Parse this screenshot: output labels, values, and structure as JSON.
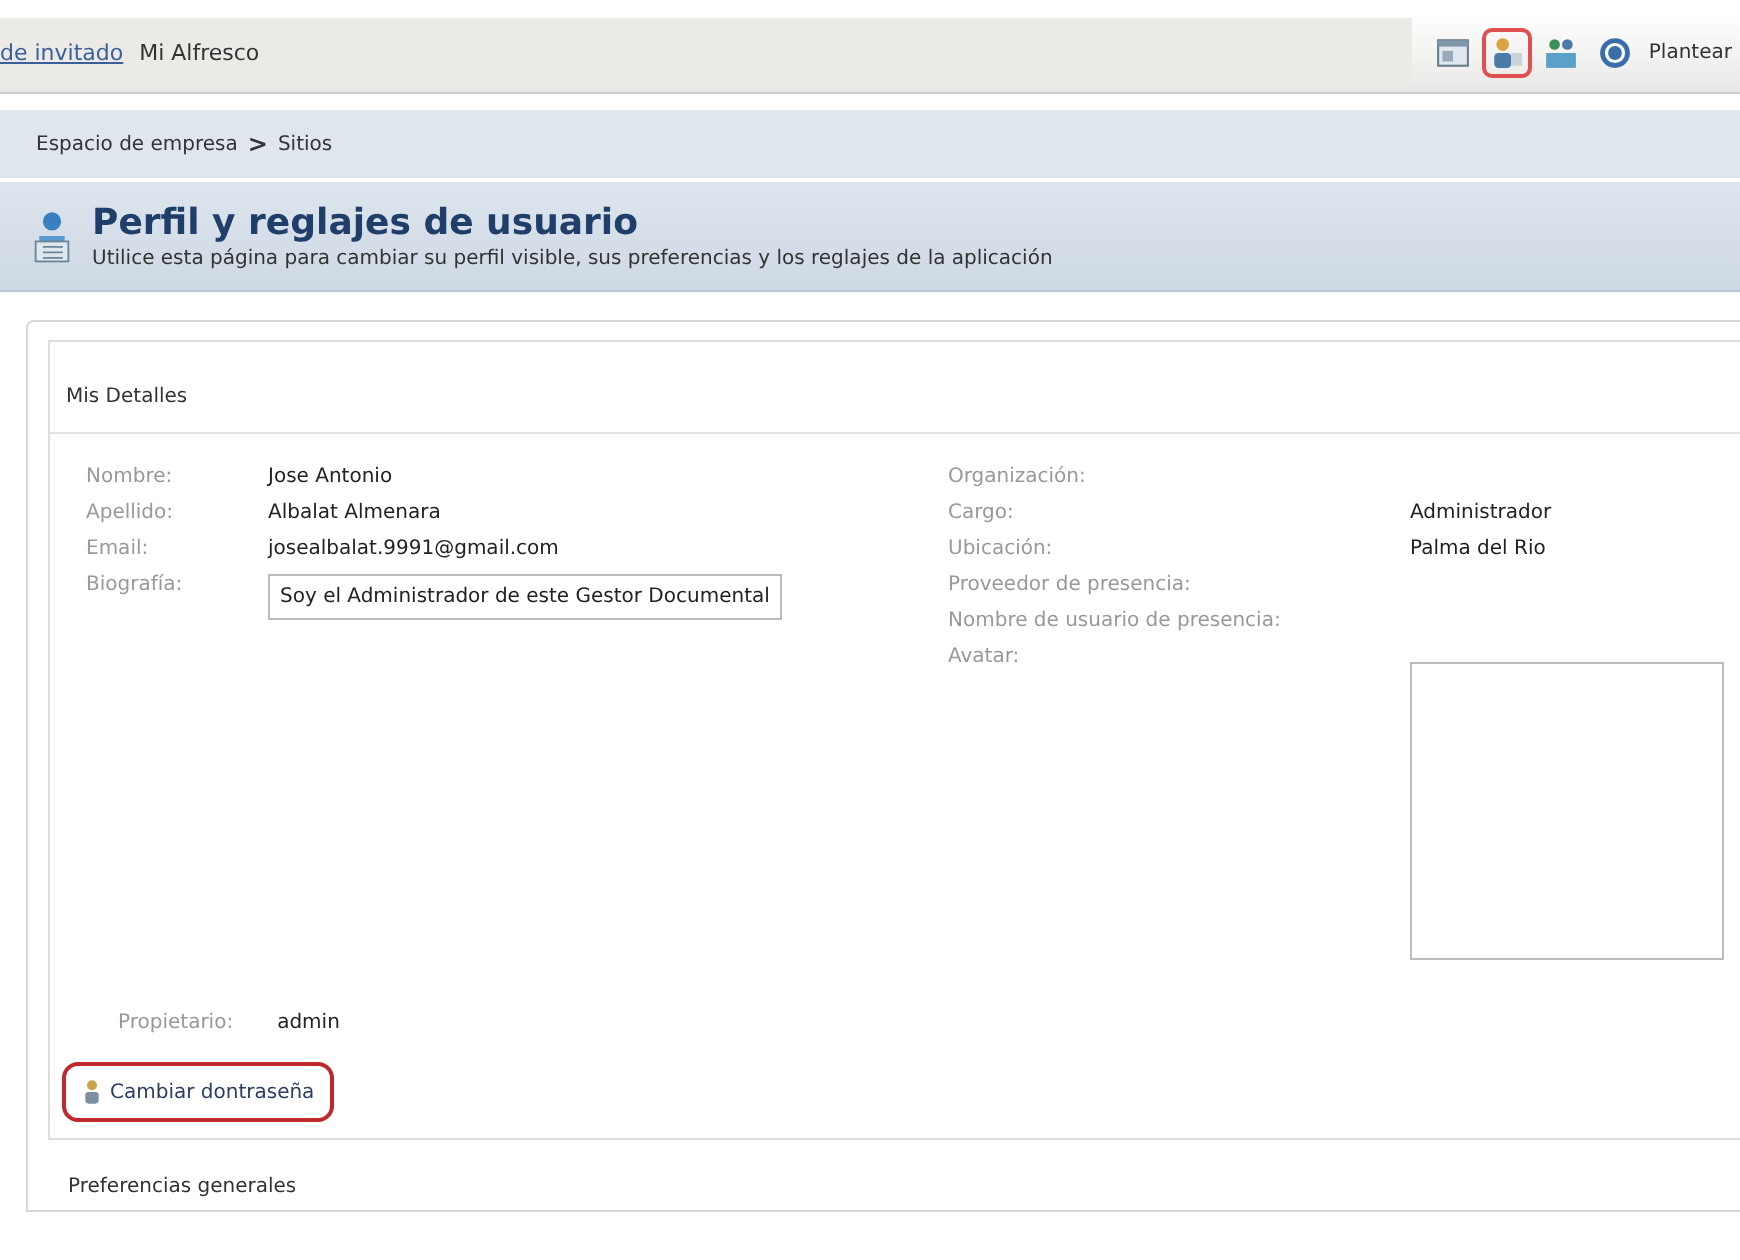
{
  "top_bar": {
    "links": [
      {
        "label": "de invitado",
        "kind": "link"
      },
      {
        "label": "Mi Alfresco",
        "kind": "plain"
      }
    ],
    "icons": [
      {
        "kind": "window",
        "highlighted": false
      },
      {
        "kind": "user",
        "highlighted": true
      },
      {
        "kind": "group",
        "highlighted": false
      },
      {
        "kind": "help",
        "highlighted": false
      }
    ],
    "help_label": "Plantear"
  },
  "breadcrumb": {
    "items": [
      "Espacio de empresa",
      "Sitios"
    ],
    "separator": ">"
  },
  "header": {
    "title": "Perfil y reglajes de usuario",
    "description": "Utilice esta página para cambiar su perfil visible, sus preferencias y los reglajes de la aplicación"
  },
  "details": {
    "title": "Mis Detalles",
    "left_fields": [
      {
        "label": "Nombre:",
        "value": "Jose Antonio",
        "kind": "text"
      },
      {
        "label": "Apellido:",
        "value": "Albalat Almenara",
        "kind": "text"
      },
      {
        "label": "Email:",
        "value": "josealbalat.9991@gmail.com",
        "kind": "text"
      },
      {
        "label": "Biografía:",
        "value": "Soy el Administrador de este Gestor Documental",
        "kind": "box"
      }
    ],
    "right_fields": [
      {
        "label": "Organización:",
        "kind": "text"
      },
      {
        "label": "Cargo:",
        "value": "Administrador",
        "kind": "text"
      },
      {
        "label": "Ubicación:",
        "value": "Palma del Rio",
        "kind": "text"
      },
      {
        "label": "Proveedor de presencia:",
        "kind": "text"
      },
      {
        "label": "Nombre de usuario de presencia:",
        "kind": "text"
      },
      {
        "label": "Avatar:",
        "kind": "avatar"
      }
    ],
    "owner": {
      "label": "Propietario:",
      "value": "admin"
    },
    "change_password": {
      "label": "Cambiar dontraseña",
      "highlighted": true
    }
  },
  "next_section": "Preferencias generales"
}
